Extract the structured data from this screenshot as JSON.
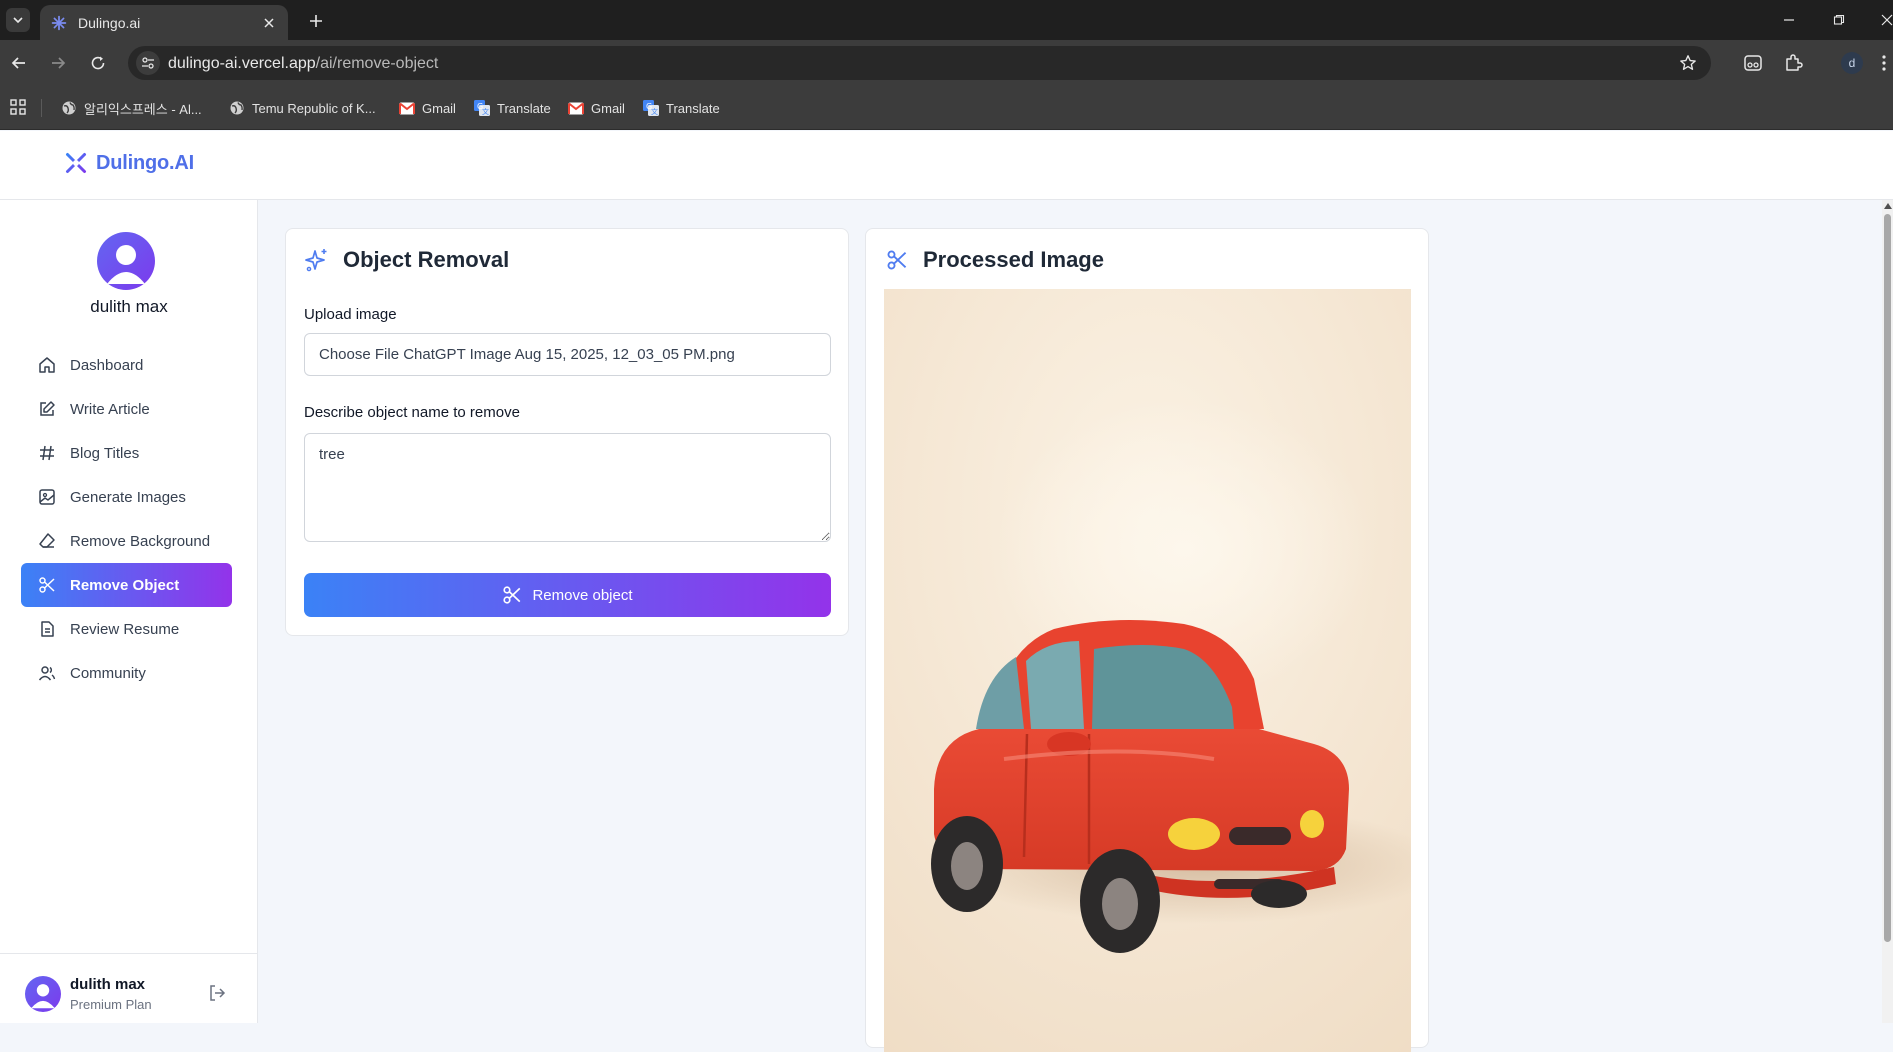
{
  "browser": {
    "tab_title": "Dulingo.ai",
    "url_host": "dulingo-ai.vercel.app",
    "url_path": "/ai/remove-object",
    "profile_initial": "d",
    "bookmarks": [
      {
        "label": "알리익스프레스 - Al...",
        "icon": "globe-icon"
      },
      {
        "label": "Temu Republic of K...",
        "icon": "globe-icon"
      },
      {
        "label": "Gmail",
        "icon": "gmail-icon"
      },
      {
        "label": "Translate",
        "icon": "translate-icon"
      },
      {
        "label": "Gmail",
        "icon": "gmail-icon"
      },
      {
        "label": "Translate",
        "icon": "translate-icon"
      }
    ]
  },
  "app": {
    "brand": "Dulingo.AI",
    "brand_color": "#4f6fe8",
    "accent_gradient": [
      "#3b82f6",
      "#9333ea"
    ]
  },
  "sidebar": {
    "user_name": "dulith max",
    "items": [
      {
        "label": "Dashboard",
        "icon": "home-icon",
        "active": false
      },
      {
        "label": "Write Article",
        "icon": "edit-icon",
        "active": false
      },
      {
        "label": "Blog Titles",
        "icon": "hash-icon",
        "active": false
      },
      {
        "label": "Generate Images",
        "icon": "image-icon",
        "active": false
      },
      {
        "label": "Remove Background",
        "icon": "eraser-icon",
        "active": false
      },
      {
        "label": "Remove Object",
        "icon": "scissors-icon",
        "active": true
      },
      {
        "label": "Review Resume",
        "icon": "file-text-icon",
        "active": false
      },
      {
        "label": "Community",
        "icon": "users-icon",
        "active": false
      }
    ],
    "footer": {
      "name": "dulith max",
      "plan": "Premium Plan"
    }
  },
  "form": {
    "title": "Object Removal",
    "upload_label": "Upload image",
    "file_value": "Choose File ChatGPT Image Aug 15, 2025, 12_03_05 PM.png",
    "describe_label": "Describe object name to remove",
    "describe_value": "tree",
    "button_label": "Remove object"
  },
  "result": {
    "title": "Processed Image"
  }
}
